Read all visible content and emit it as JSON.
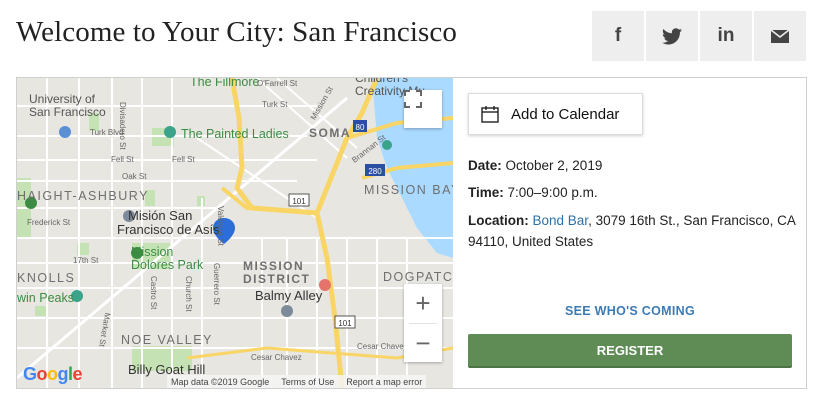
{
  "page": {
    "title": "Welcome to Your City: San Francisco"
  },
  "share": [
    {
      "label": "f",
      "icon": "facebook-icon"
    },
    {
      "label": "twitter",
      "icon": "twitter-icon"
    },
    {
      "label": "in",
      "icon": "linkedin-icon"
    },
    {
      "label": "email",
      "icon": "email-icon"
    }
  ],
  "map": {
    "labels": {
      "university": "University of\nSan Francisco",
      "fillmore": "The Fillmore",
      "ofarrell": "O'Farrell St",
      "childrens": "Children's\nCreativity Mu",
      "turk_blvd": "Turk Blvd",
      "divisadero": "Divisadero St",
      "painted_ladies": "The Painted Ladies",
      "turk_st": "Turk St",
      "mission_st": "Mission St",
      "soma": "SOMA",
      "hwy80": "80",
      "fell1": "Fell St",
      "fell2": "Fell St",
      "oak": "Oak St",
      "brannan": "Brannan St",
      "hwy280": "280",
      "mission_bay": "MISSION BAY",
      "haight": "HAIGHT-ASHBURY",
      "frederick": "Frederick St",
      "hwy101a": "101",
      "mision_san": "Misión San",
      "francisco_asis": "Francisco de Asís",
      "valencia": "Valencia St",
      "mission_dolores": "Mission\nDolores Park",
      "st17": "17th St",
      "mission_district": "MISSION\nDISTRICT",
      "dogpatch": "DOGPATCH",
      "knolls": "KNOLLS",
      "twin_peaks": "win Peaks",
      "castro": "Castro St",
      "church": "Church St",
      "guerrero": "Guerrero St",
      "balmy": "Balmy Alley",
      "market": "Market St",
      "hwy101b": "101",
      "noe_valley": "NOE VALLEY",
      "cesar": "Cesar Chavez",
      "billy_goat": "Billy Goat Hill",
      "cesar_st": "Cesar Chavez St"
    },
    "google": "Google",
    "attribution": {
      "data": "Map data ©2019 Google",
      "terms": "Terms of Use",
      "report": "Report a map error"
    },
    "zoom_in": "+",
    "zoom_out": "−"
  },
  "event": {
    "add_to_calendar": "Add to Calendar",
    "date_label": "Date:",
    "date_value": " October 2, 2019",
    "time_label": "Time:",
    "time_value": " 7:00–9:00 p.m.",
    "location_label": "Location:",
    "location_link": "Bond Bar",
    "location_value": ", 3079 16th St., San Francisco, CA 94110, United States",
    "see_who": "SEE WHO'S COMING",
    "register": "REGISTER"
  },
  "colors": {
    "register_bg": "#5f8b55",
    "link": "#2f6fa8",
    "see_who": "#3c7bb5",
    "park_green": "#c5e2b4",
    "highway": "#f8d565",
    "marker": "#2b6ed9"
  }
}
